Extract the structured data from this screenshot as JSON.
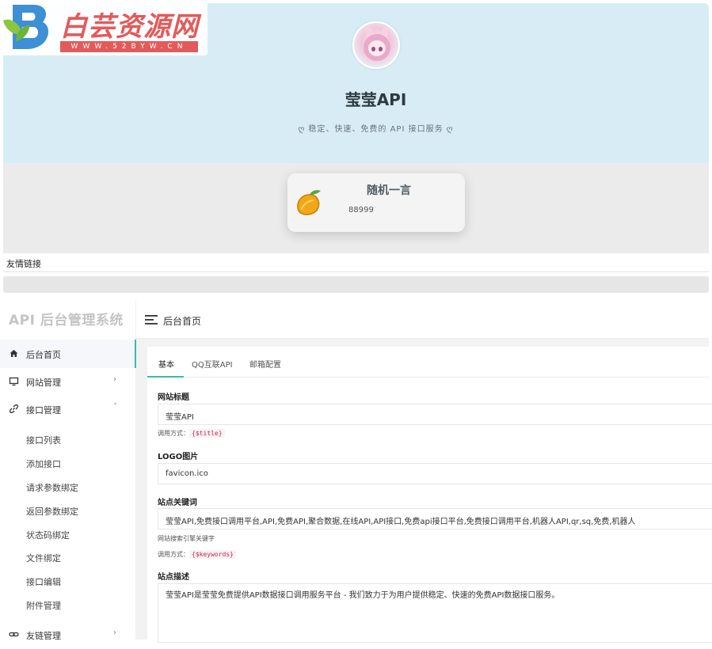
{
  "watermark": {
    "title": "白芸资源网",
    "subtitle": "WWW.52BYW.CN"
  },
  "preview": {
    "site_title": "莹莹API",
    "site_desc": "ღ 稳定、快速、免费的 API 接口服务 ღ",
    "card_title": "随机一言",
    "card_text": "88999",
    "friend_links": "友情链接"
  },
  "admin": {
    "brand": "API 后台管理系统",
    "breadcrumb": "后台首页",
    "menu": {
      "home": "后台首页",
      "site": "网站管理",
      "api": "接口管理",
      "links": "友链管理"
    },
    "submenu": [
      "接口列表",
      "添加接口",
      "请求参数绑定",
      "返回参数绑定",
      "状态码绑定",
      "文件绑定",
      "接口编辑",
      "附件管理"
    ],
    "tabs": [
      "基本",
      "QQ互联API",
      "邮箱配置"
    ],
    "form": {
      "title_label": "网站标题",
      "title_value": "莹莹API",
      "title_hint": "调用方式：",
      "title_code": "{$title}",
      "logo_label": "LOGO图片",
      "logo_value": "favicon.ico",
      "keywords_label": "站点关键词",
      "keywords_value": "莹莹API,免费接口调用平台,API,免费API,聚合数据,在线API,API接口,免费api接口平台,免费接口调用平台,机器人API,qr,sq,免费,机器人",
      "keywords_hint": "网站搜索引擎关键字",
      "keywords_hint2": "调用方式：",
      "keywords_code": "{$keywords}",
      "desc_label": "站点描述",
      "desc_value": "莹莹API是莹莹免费提供API数据接口调用服务平台 - 我们致力于为用户提供稳定、快速的免费API数据接口服务。"
    }
  },
  "colors": {
    "hero_bg": "#d8ecf5",
    "accent": "#3eb8b0",
    "watermark_red": "#e35a5a"
  },
  "icons": [
    "home-icon",
    "monitor-icon",
    "link-icon",
    "chevron-right-icon",
    "chevron-down-icon",
    "menu-icon",
    "mango-icon"
  ]
}
